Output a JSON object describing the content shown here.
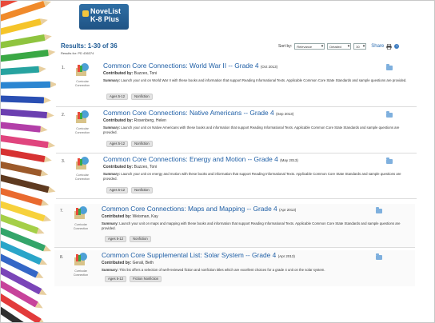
{
  "logo": {
    "line1": "NoveList",
    "line2": "K-8 Plus"
  },
  "results": {
    "heading": "Results: 1-30 of 36",
    "results_for": "Results for: PD 436374"
  },
  "toolbar": {
    "sort_by_label": "Sort by:",
    "sort_value": "Relevance",
    "view_value": "Detailed",
    "per_page_value": "30",
    "share_label": "Share",
    "help_glyph": "?"
  },
  "icons": {
    "print": "print-icon",
    "help": "help-icon",
    "folder": "folder-icon",
    "thumb": "curricular-connection-icon"
  },
  "items": [
    {
      "num": "1.",
      "thumb_label": "Curricular Connection",
      "title": "Common Core Connections: World War II -- Grade 4",
      "date": "(Oct 2013)",
      "contrib_label": "Contributed by:",
      "contributor": "Buzzeo, Toni",
      "summary_label": "Summary:",
      "summary": "Launch your unit on World War II with these books and information that support Reading Informational Texts. Applicable Common Core State Standards and sample questions are provided.",
      "tags": [
        "Ages 5-12",
        "Nonfiction"
      ]
    },
    {
      "num": "2.",
      "thumb_label": "Curricular Connection",
      "title": "Common Core Connections: Native Americans -- Grade 4",
      "date": "(Sep 2013)",
      "contrib_label": "Contributed by:",
      "contributor": "Rosenberg, Helen",
      "summary_label": "Summary:",
      "summary": "Launch your unit on Native Americans with these books and information that support Reading Informational Texts. Applicable Common Core State Standards and sample questions are provided.",
      "tags": [
        "Ages 5-12",
        "Nonfiction"
      ]
    },
    {
      "num": "3.",
      "thumb_label": "Curricular Connection",
      "title": "Common Core Connections: Energy and Motion -- Grade 4",
      "date": "(May 2013)",
      "contrib_label": "Contributed by:",
      "contributor": "Buzzeo, Toni",
      "summary_label": "Summary:",
      "summary": "Launch your unit on energy and motion with these books and information that support Reading Informational Texts. Applicable Common Core State Standards and sample questions are provided.",
      "tags": [
        "Ages 5-12",
        "Nonfiction"
      ]
    },
    {
      "num": "7.",
      "thumb_label": "Curricular Connection",
      "title": "Common Core Connections: Maps and Mapping -- Grade 4",
      "date": "(Apr 2013)",
      "contrib_label": "Contributed by:",
      "contributor": "Weisman, Kay",
      "summary_label": "Summary:",
      "summary": "Launch your unit on maps and mapping with these books and information that support Reading Informational Texts. Applicable Common Core State Standards and sample questions are provided.",
      "tags": [
        "Ages 5-12",
        "Nonfiction"
      ]
    },
    {
      "num": "8.",
      "thumb_label": "Curricular Connection",
      "title": "Common Core Supplemental List: Solar System -- Grade 4",
      "date": "(Apr 2013)",
      "contrib_label": "Contributed by:",
      "contributor": "Gerali, Beth",
      "summary_label": "Summary:",
      "summary": "This list offers a selection of well-reviewed fiction and nonfiction titles which are excellent choices for a grade 4 unit on the solar system.",
      "tags": [
        "Ages 5-12",
        "Fiction Nonfiction"
      ]
    }
  ]
}
